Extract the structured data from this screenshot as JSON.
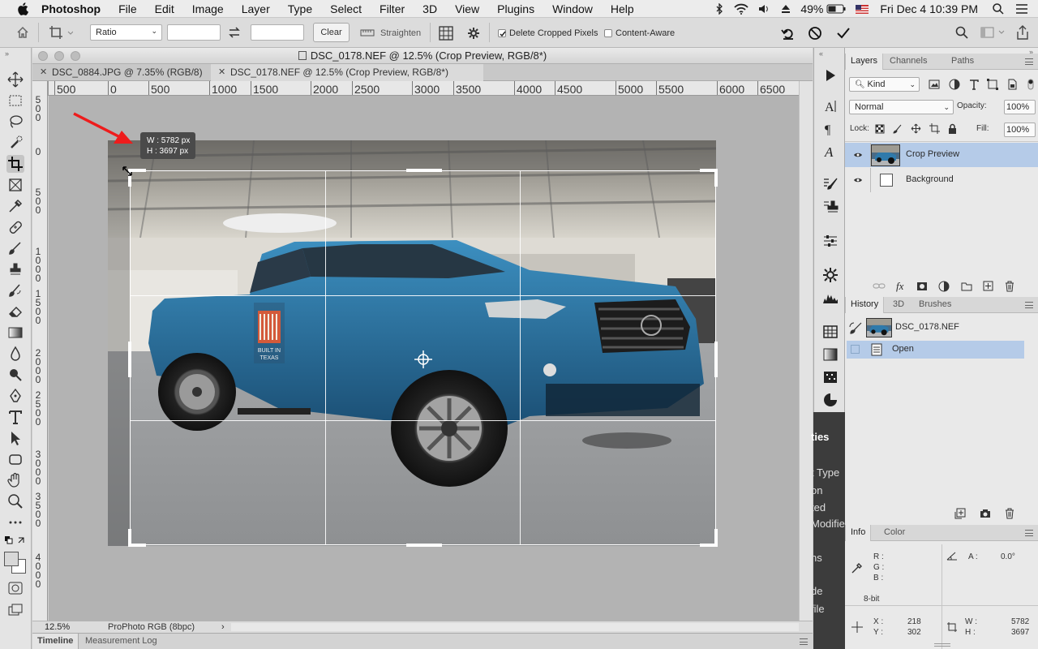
{
  "menubar": {
    "app": "Photoshop",
    "items": [
      "File",
      "Edit",
      "Image",
      "Layer",
      "Type",
      "Select",
      "Filter",
      "3D",
      "View",
      "Plugins",
      "Window",
      "Help"
    ],
    "battery": "49%",
    "datetime": "Fri Dec 4  10:39 PM"
  },
  "options": {
    "ratio": "Ratio",
    "width_value": "",
    "height_value": "",
    "clear": "Clear",
    "straighten": "Straighten",
    "delete_cropped": "Delete Cropped Pixels",
    "delete_cropped_checked": true,
    "content_aware": "Content-Aware",
    "content_aware_checked": false
  },
  "document": {
    "window_title": "DSC_0178.NEF @ 12.5% (Crop Preview, RGB/8*)",
    "tabs": [
      {
        "label": "DSC_0884.JPG @ 7.35% (RGB/8) *",
        "active": false
      },
      {
        "label": "DSC_0178.NEF @ 12.5% (Crop Preview, RGB/8*)",
        "active": true
      }
    ],
    "h_ruler": [
      "500",
      "0",
      "500",
      "1000",
      "1500",
      "2000",
      "2500",
      "3000",
      "3500",
      "4000",
      "4500",
      "5000",
      "5500",
      "6000",
      "6500"
    ],
    "v_ruler": [
      "500",
      "0",
      "500",
      "1000",
      "1500",
      "2000",
      "2500",
      "3000",
      "3500",
      "4000"
    ],
    "tooltip_w": "W : 5782 px",
    "tooltip_h": "H : 3697 px",
    "photo_badge": [
      "BUILT IN",
      "TEXAS"
    ],
    "zoom": "12.5%",
    "profile": "ProPhoto RGB (8bpc)",
    "arrow_color": "#ee1c1c"
  },
  "bottom_tabs": [
    "Timeline",
    "Measurement Log"
  ],
  "layers_panel": {
    "tabs": [
      "Layers",
      "Channels",
      "Paths"
    ],
    "kind": "Kind",
    "blend": "Normal",
    "opacity_label": "Opacity:",
    "opacity": "100%",
    "lock_label": "Lock:",
    "fill_label": "Fill:",
    "fill": "100%",
    "layers": [
      {
        "name": "Crop Preview",
        "selected": true
      },
      {
        "name": "Background",
        "selected": false
      }
    ]
  },
  "history_panel": {
    "tabs": [
      "History",
      "3D",
      "Brushes"
    ],
    "snapshot": "DSC_0178.NEF",
    "items": [
      {
        "name": "Open",
        "selected": true
      }
    ]
  },
  "dark_panel_fragments": [
    "ties",
    "t Type",
    "on",
    "ted",
    "Modifie",
    "ns",
    "de",
    "file"
  ],
  "info_panel": {
    "tabs": [
      "Info",
      "Color"
    ],
    "r": "R :",
    "g": "G :",
    "b": "B :",
    "a_label": "A :",
    "a_value": "0.0°",
    "bitdepth": "8-bit",
    "x_label": "X :",
    "x_value": "218",
    "y_label": "Y :",
    "y_value": "302",
    "w_label": "W :",
    "w_value": "5782",
    "h_label": "H :",
    "h_value": "3697"
  }
}
